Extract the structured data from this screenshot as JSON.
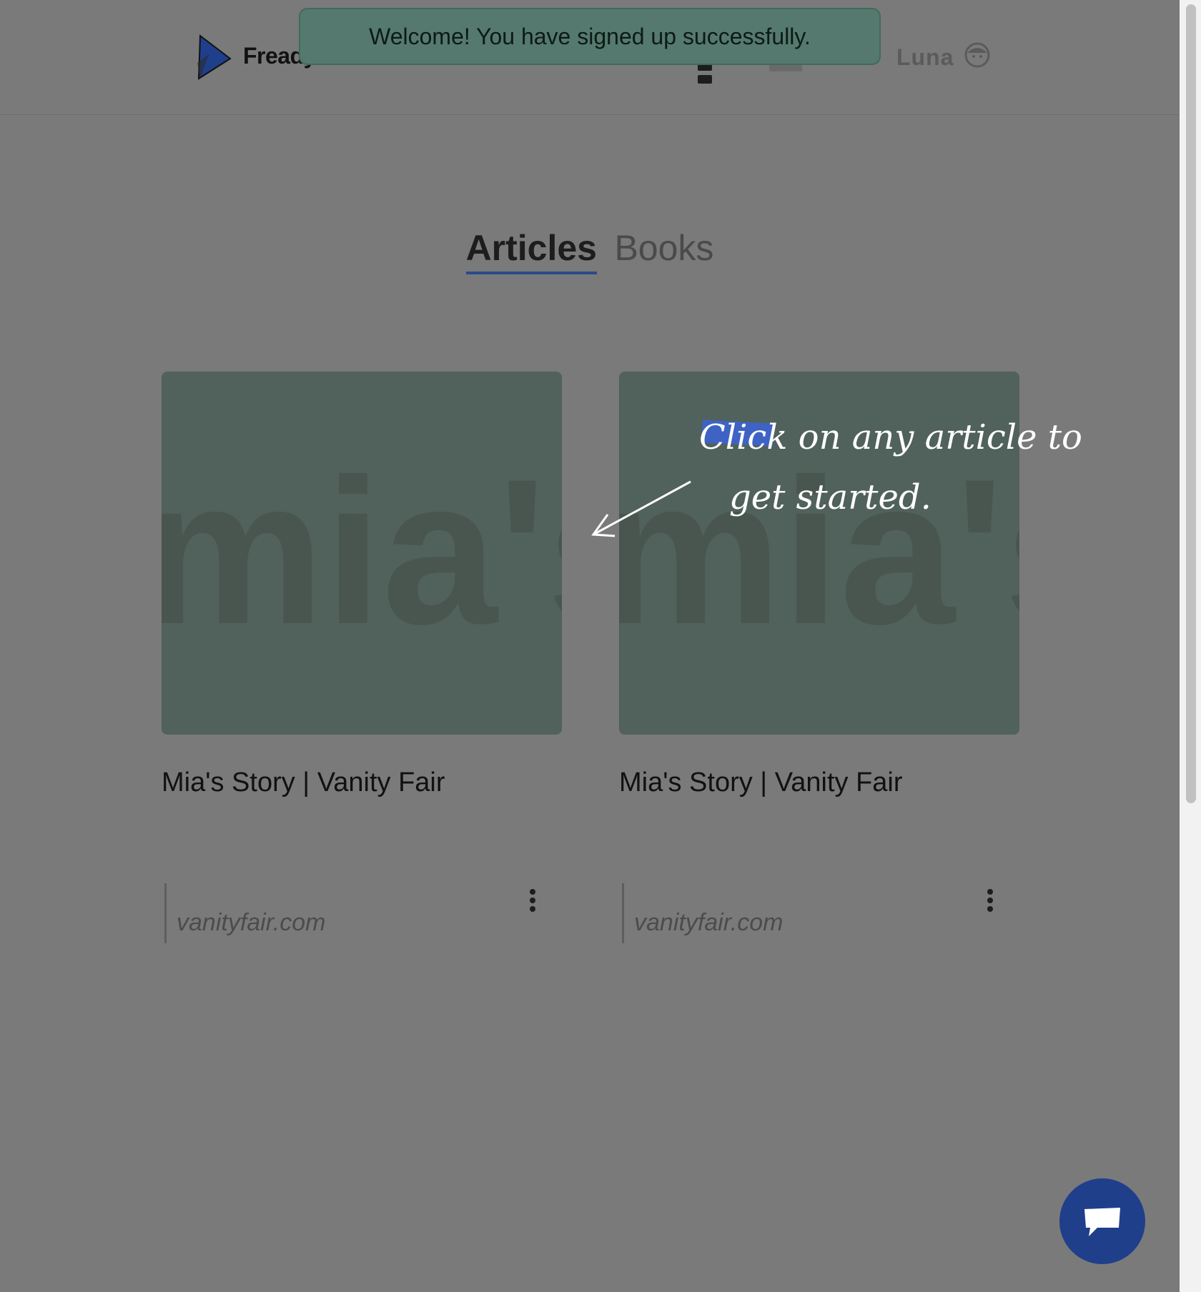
{
  "header": {
    "brand": "Fready",
    "username": "Luna"
  },
  "toast": {
    "message": "Welcome! You have signed up successfully."
  },
  "tabs": [
    {
      "label": "Articles",
      "active": true
    },
    {
      "label": "Books",
      "active": false
    }
  ],
  "cards": [
    {
      "title": "Mia's Story | Vanity Fair",
      "domain": "vanityfair.com",
      "thumbnail_text": "mia's"
    },
    {
      "title": "Mia's Story | Vanity Fair",
      "domain": "vanityfair.com",
      "thumbnail_text": "mia's"
    }
  ],
  "onboarding": {
    "line1_highlight": "Click",
    "line1_rest": " on any article to",
    "line2": "get started."
  },
  "colors": {
    "accent": "#1f3f8b",
    "toast_bg": "#55796e",
    "card_bg": "#51615c",
    "overlay": "#7a7a7a"
  },
  "icons": {
    "chat": "chat-bubble-icon",
    "menu": "kebab-menu-icon",
    "avatar": "avatar-icon"
  }
}
